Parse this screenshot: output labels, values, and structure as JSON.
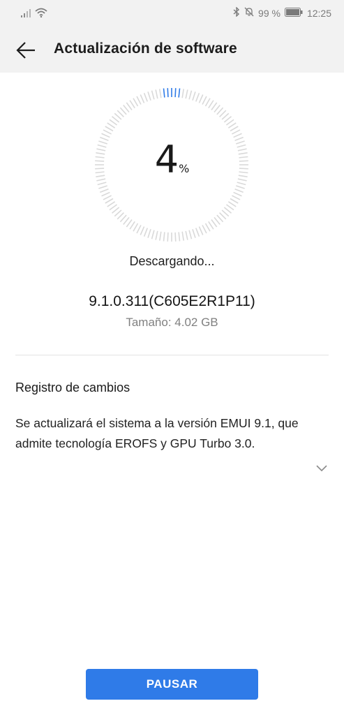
{
  "status_bar": {
    "battery": "99 %",
    "time": "12:25",
    "icons": [
      "signal-icon",
      "wifi-icon",
      "bluetooth-icon",
      "mute-bell-icon",
      "battery-icon"
    ]
  },
  "header": {
    "title": "Actualización de software",
    "back_icon": "back-arrow-icon"
  },
  "progress": {
    "value": "4",
    "unit": "%",
    "fraction": 0.04,
    "status": "Descargando...",
    "active_color": "#2f7be8",
    "track_color": "#d9d9d9"
  },
  "update": {
    "version": "9.1.0.311(C605E2R1P11)",
    "size": "Tamaño: 4.02 GB"
  },
  "changelog": {
    "title": "Registro de cambios",
    "text": "Se actualizará el sistema a la versión EMUI 9.1, que admite tecnología EROFS y GPU Turbo 3.0.",
    "expand_icon": "chevron-down-icon"
  },
  "actions": {
    "pause_label": "PAUSAR",
    "accent": "#2f7be8"
  }
}
